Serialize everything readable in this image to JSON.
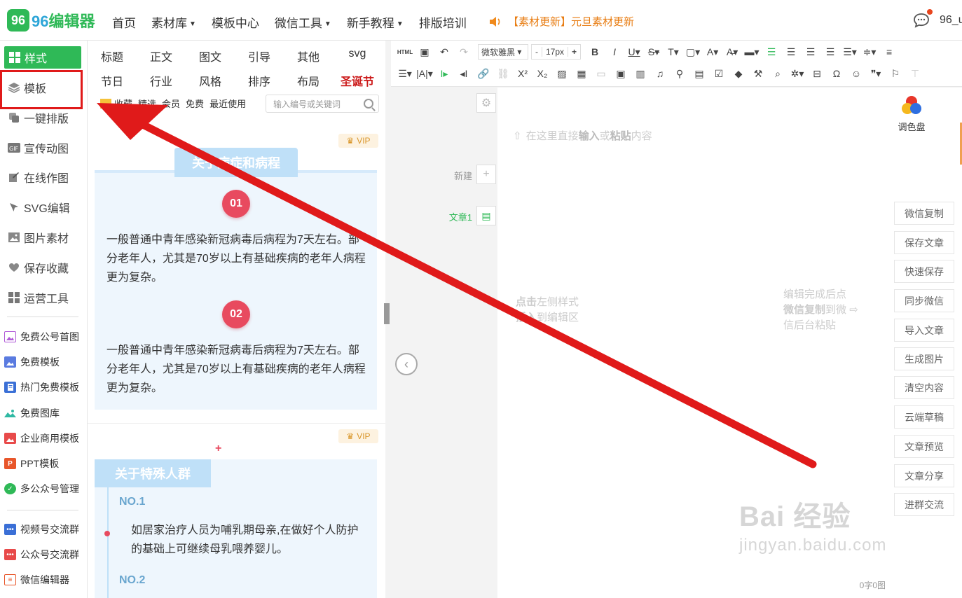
{
  "brand": {
    "logo_mark": "96",
    "name_part1": "96",
    "name_part2": "编辑器",
    "accent": "#2fb957"
  },
  "nav": {
    "items": [
      {
        "label": "首页",
        "dropdown": false
      },
      {
        "label": "素材库",
        "dropdown": true
      },
      {
        "label": "模板中心",
        "dropdown": false
      },
      {
        "label": "微信工具",
        "dropdown": true
      },
      {
        "label": "新手教程",
        "dropdown": true
      },
      {
        "label": "排版培训",
        "dropdown": false
      }
    ],
    "notice": "【素材更新】元旦素材更新",
    "user": "96_u"
  },
  "sidebar": {
    "main": [
      {
        "label": "样式",
        "icon": "grid-icon"
      },
      {
        "label": "模板",
        "icon": "layers-icon"
      },
      {
        "label": "一键排版",
        "icon": "copy-icon"
      },
      {
        "label": "宣传动图",
        "icon": "gif-icon"
      },
      {
        "label": "在线作图",
        "icon": "edit-icon"
      },
      {
        "label": "SVG编辑",
        "icon": "cursor-icon"
      },
      {
        "label": "图片素材",
        "icon": "image-icon"
      },
      {
        "label": "保存收藏",
        "icon": "heart-icon"
      },
      {
        "label": "运营工具",
        "icon": "apps-icon"
      }
    ],
    "links": [
      {
        "label": "免费公号首图",
        "color": "#b05ad8"
      },
      {
        "label": "免费模板",
        "color": "#5a7be0"
      },
      {
        "label": "热门免费模板",
        "color": "#3a6fd6"
      },
      {
        "label": "免费图库",
        "color": "#2fb9a3"
      },
      {
        "label": "企业商用模板",
        "color": "#e84a4a"
      },
      {
        "label": "PPT模板",
        "color": "#e8562a"
      },
      {
        "label": "多公众号管理",
        "color": "#2fb957"
      }
    ],
    "groups": [
      {
        "label": "视频号交流群",
        "color": "#3a6fd6"
      },
      {
        "label": "公众号交流群",
        "color": "#e84a4a"
      },
      {
        "label": "微信编辑器",
        "color": "#e8562a"
      }
    ]
  },
  "panel": {
    "categories_row1": [
      "标题",
      "正文",
      "图文",
      "引导",
      "其他",
      "svg"
    ],
    "categories_row2": [
      "节日",
      "行业",
      "风格",
      "排序",
      "布局",
      "圣诞节"
    ],
    "filters": [
      "收藏",
      "精选",
      "会员",
      "免费",
      "最近使用"
    ],
    "search_placeholder": "输入编号或关键词",
    "vip_label": "VIP",
    "card1": {
      "title": "关于病症和病程",
      "badge1": "01",
      "text1": "一般普通中青年感染新冠病毒后病程为7天左右。部分老年人，尤其是70岁以上有基础疾病的老年人病程更为复杂。",
      "badge2": "02",
      "text2": "一般普通中青年感染新冠病毒后病程为7天左右。部分老年人，尤其是70岁以上有基础疾病的老年人病程更为复杂。"
    },
    "card2": {
      "title": "关于特殊人群",
      "no1": "NO.1",
      "text1": "如居家治疗人员为哺乳期母亲,在做好个人防护的基础上可继续母乳喂养婴儿。",
      "no2": "NO.2"
    }
  },
  "toolbar": {
    "font": "微软雅黑",
    "size_minus": "-",
    "size": "17px",
    "size_plus": "+",
    "html_label": "HTML"
  },
  "editor": {
    "new_label": "新建",
    "doc_label": "文章1",
    "canvas_hint_pre": "在这里直接",
    "canvas_hint_b1": "输入",
    "canvas_hint_mid": "或",
    "canvas_hint_b2": "粘贴",
    "canvas_hint_post": "内容",
    "left_hint_b1": "点击",
    "left_hint_1": "左侧样式",
    "left_hint_b2": "插入",
    "left_hint_2": "到编辑区",
    "right_hint_1": "编辑完成后点",
    "right_hint_b": "微信复制",
    "right_hint_2": "到微",
    "right_hint_3": "信后台粘贴",
    "word_count": "0字0图"
  },
  "right_panel": {
    "palette_label": "调色盘",
    "actions": [
      "微信复制",
      "保存文章",
      "快速保存",
      "同步微信",
      "导入文章",
      "生成图片",
      "清空内容",
      "云端草稿",
      "文章预览",
      "文章分享",
      "进群交流"
    ]
  },
  "annotation": {
    "arrow_color": "#e01a1a"
  },
  "watermark": {
    "main": "Bai 经验",
    "sub": "jingyan.baidu.com"
  }
}
